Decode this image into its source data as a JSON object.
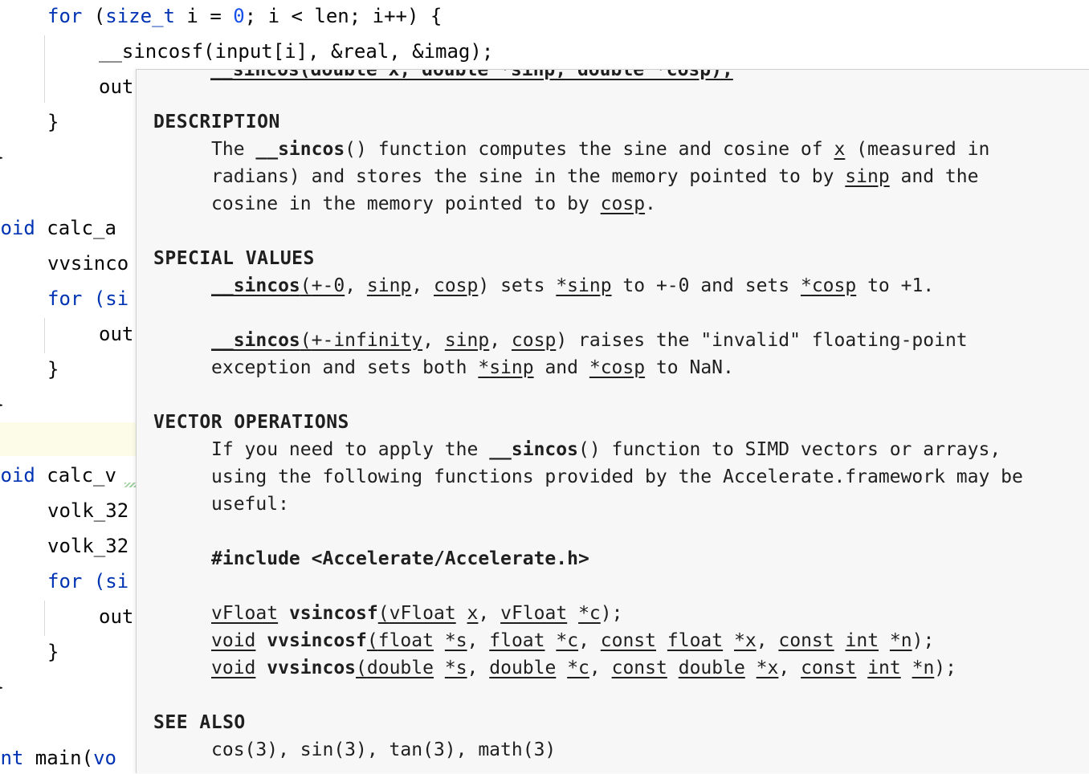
{
  "editor": {
    "lines": [
      {
        "kw": "for",
        "rest1": " (",
        "typ": "size_t",
        "rest2": " i = ",
        "num": "0",
        "rest3": "; i < len; i++) {"
      },
      {
        "text": "__sincosf(input[i], &real, &imag);"
      },
      {
        "text": "out"
      },
      {
        "text": "}"
      },
      {
        "text": "}"
      },
      {
        "kw": "void",
        "rest": " calc_a"
      },
      {
        "text": "vvsinco"
      },
      {
        "kw": "for",
        "rest": " (si"
      },
      {
        "text": "out"
      },
      {
        "text": "}"
      },
      {
        "text": "}"
      },
      {
        "kw": "void",
        "rest": " calc_v"
      },
      {
        "text": "volk_32"
      },
      {
        "text": "volk_32"
      },
      {
        "kw": "for",
        "rest": " (si"
      },
      {
        "text": "out"
      },
      {
        "text": "}"
      },
      {
        "text": "}"
      },
      {
        "kw": "int",
        "rest": " main(",
        "kw2": "vo"
      }
    ]
  },
  "doc": {
    "cut_top": "__sincos(double x, double *sinp, double *cosp);",
    "description_heading": "DESCRIPTION",
    "desc": {
      "l1a": "The ",
      "l1f": "__sincos",
      "l1b": "() function computes the sine and cosine of ",
      "l1x": "x",
      "l1c": " (measured in",
      "l2a": "radians) and stores the sine in the memory pointed to by ",
      "l2s": "sinp",
      "l2b": " and the",
      "l3a": "cosine in the memory pointed to by ",
      "l3c": "cosp",
      "l3b": "."
    },
    "special_heading": "SPECIAL VALUES",
    "special": {
      "s1f": "__sincos",
      "s1p": "(",
      "s1a": "+-0",
      "s1c1": ", ",
      "s1s": "sinp",
      "s1c2": ", ",
      "s1cs": "cosp",
      "s1t": ") sets ",
      "s1ps": "*sinp",
      "s1m": " to +-0 and sets ",
      "s1pc": "*cosp",
      "s1e": " to +1.",
      "s2f": "__sincos",
      "s2p": "(",
      "s2a": "+-infinity",
      "s2c1": ", ",
      "s2s": "sinp",
      "s2c2": ", ",
      "s2cs": "cosp",
      "s2t": ") raises the \"invalid\" floating-point",
      "s3a": "exception and sets both ",
      "s3s": "*sinp",
      "s3m": " and ",
      "s3c": "*cosp",
      "s3e": " to NaN."
    },
    "vector_heading": "VECTOR OPERATIONS",
    "vector": {
      "v1a": "If you need to apply the ",
      "v1f": "__sincos",
      "v1b": "() function to SIMD vectors or arrays,",
      "v2": "using the following functions provided by the Accelerate.framework may be",
      "v3": "useful:",
      "include": "#include <Accelerate/Accelerate.h>",
      "f1": [
        "vFloat",
        " ",
        "vsincosf",
        "(",
        "vFloat",
        " ",
        "x",
        ", ",
        "vFloat",
        " ",
        "*c",
        ");"
      ],
      "f2": [
        "void",
        " ",
        "vvsincosf",
        "(",
        "float",
        " ",
        "*s",
        ", ",
        "float",
        " ",
        "*c",
        ", ",
        "const",
        " ",
        "float",
        " ",
        "*x",
        ", ",
        "const",
        " ",
        "int",
        " ",
        "*n",
        ");"
      ],
      "f3": [
        "void",
        " ",
        "vvsincos",
        "(",
        "double",
        " ",
        "*s",
        ", ",
        "double",
        " ",
        "*c",
        ", ",
        "const",
        " ",
        "double",
        " ",
        "*x",
        ", ",
        "const",
        " ",
        "int",
        " ",
        "*n",
        ");"
      ]
    },
    "seealso_heading": "SEE ALSO",
    "seealso": "cos(3), sin(3), tan(3), math(3)"
  }
}
